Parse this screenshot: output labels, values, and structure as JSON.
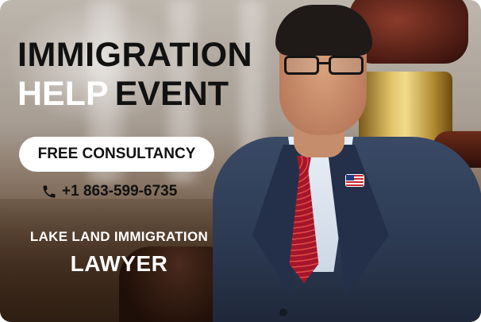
{
  "headline": {
    "line1": "IMMIGRATION",
    "line2_white": "HELP",
    "line2_dark": "EVENT"
  },
  "cta": {
    "label": "FREE CONSULTANCY"
  },
  "contact": {
    "phone": "+1 863-599-6735",
    "icon": "phone-icon"
  },
  "firm": {
    "line1": "LAKE LAND IMMIGRATION",
    "line2": "LAWYER"
  },
  "colors": {
    "headline_dark": "#111111",
    "headline_light": "#ffffff",
    "pill_background": "#ffffff",
    "tie": "#a5162a",
    "suit": "#2b3850"
  }
}
